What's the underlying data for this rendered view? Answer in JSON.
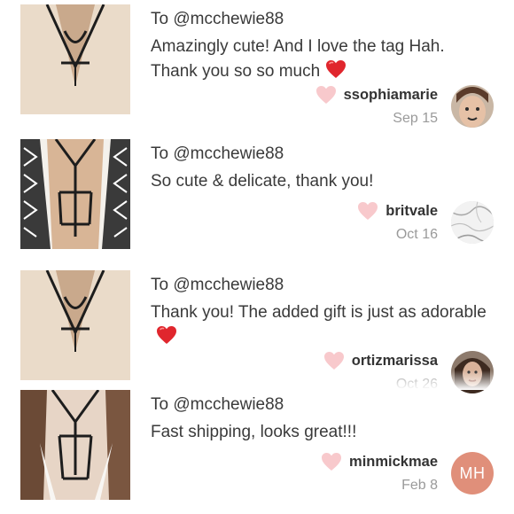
{
  "reviews": [
    {
      "to": "To @mcchewie88",
      "message": "Amazingly cute! And I love the tag Hah. Thank you so so much",
      "message_emoji": "heart",
      "username": "ssophiamarie",
      "date": "Sep 15",
      "avatar_type": "photo"
    },
    {
      "to": "To @mcchewie88",
      "message": "So cute & delicate, thank you!",
      "message_emoji": "",
      "username": "britvale",
      "date": "Oct 16",
      "avatar_type": "marble"
    },
    {
      "to": "To @mcchewie88",
      "message": "Thank you! The added gift is just as adorable",
      "message_emoji": "heart",
      "username": "ortizmarissa",
      "date": "Oct 26",
      "avatar_type": "photo"
    },
    {
      "to": "To @mcchewie88",
      "message": "Fast shipping, looks great!!!",
      "message_emoji": "",
      "username": "minmickmae",
      "date": "Feb 8",
      "avatar_type": "initials",
      "avatar_initials": "MH"
    }
  ],
  "colors": {
    "like_heart": "#f8c9cc",
    "emoji_heart": "#e0262d",
    "initials_avatar": "#e08f7a",
    "date_text": "#9a9a9a"
  }
}
